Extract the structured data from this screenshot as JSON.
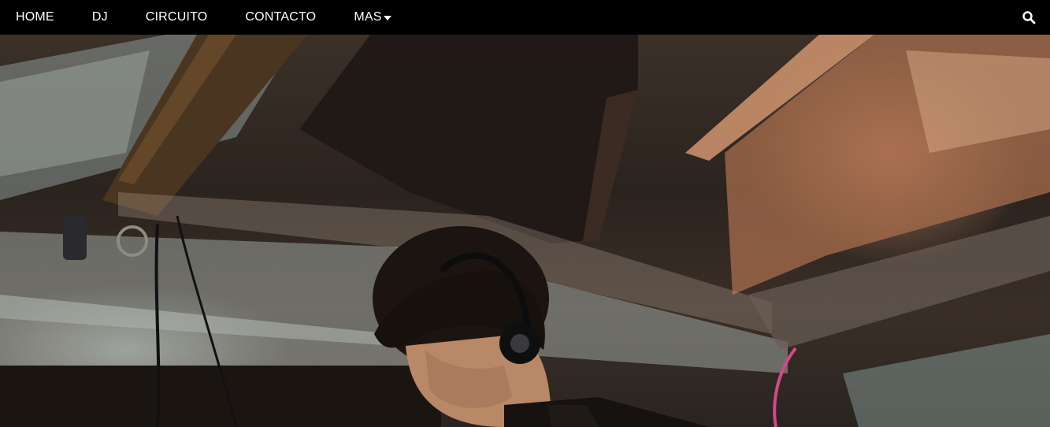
{
  "nav": {
    "items": [
      {
        "label": "HOME"
      },
      {
        "label": "DJ"
      },
      {
        "label": "CIRCUITO"
      },
      {
        "label": "CONTACTO"
      },
      {
        "label": "MAS"
      }
    ]
  },
  "icons": {
    "search": "search-icon",
    "dropdown": "caret-down-icon"
  },
  "colors": {
    "topbar": "#000000",
    "nav_text": "#ffffff"
  },
  "hero": {
    "image": "dj-with-headphones-photo"
  }
}
